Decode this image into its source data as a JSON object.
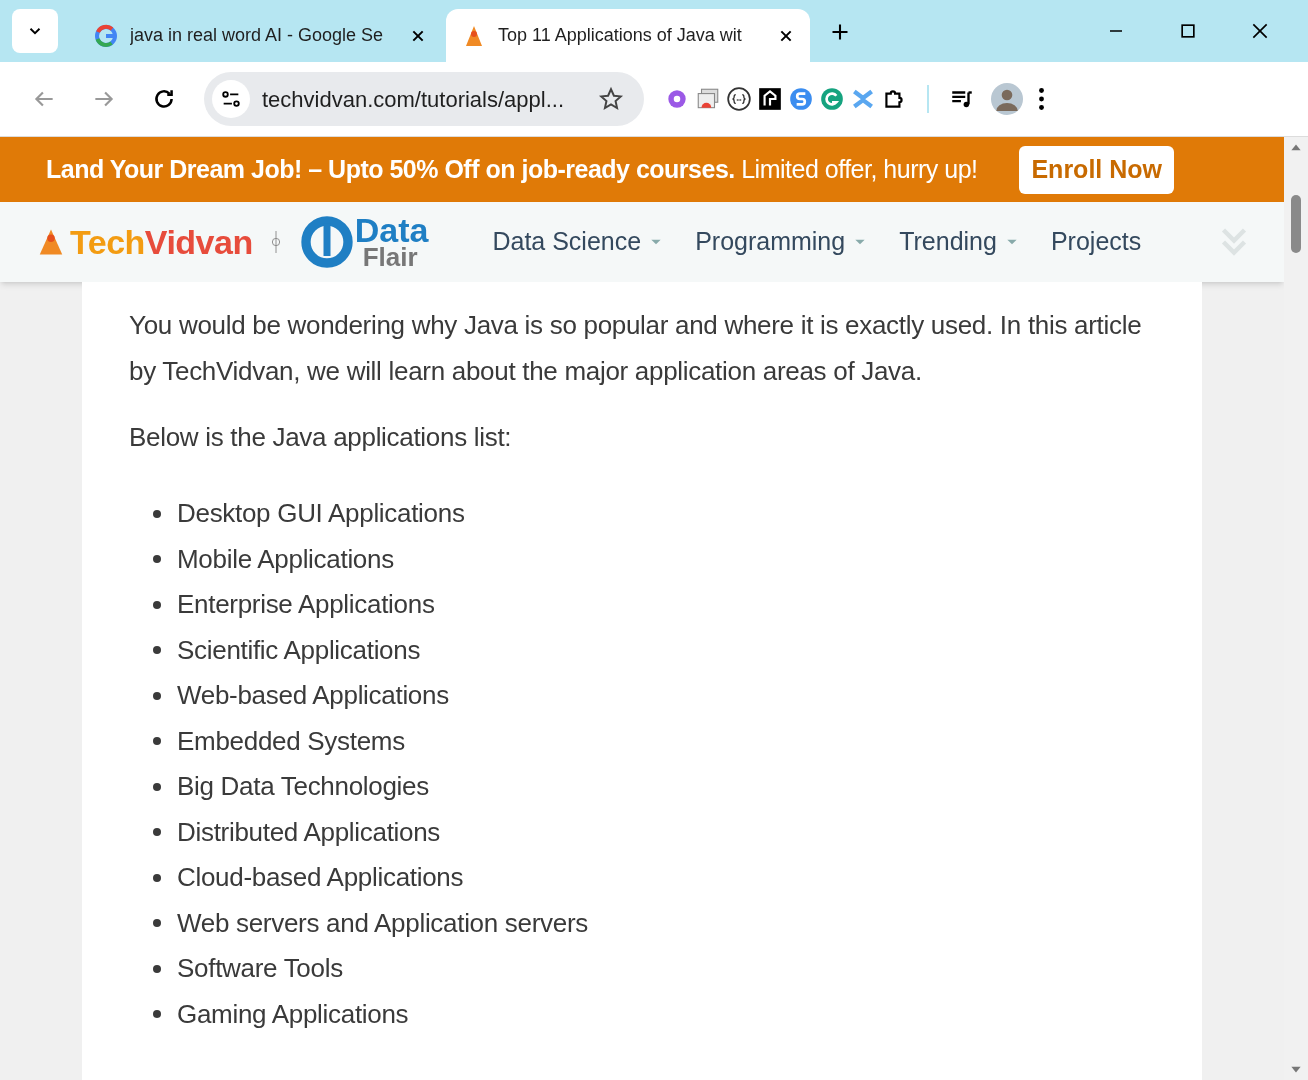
{
  "tabs": [
    {
      "title": "java in real word AI - Google Se",
      "selected": false
    },
    {
      "title": "Top 11 Applications of Java wit",
      "selected": true
    }
  ],
  "address_bar": {
    "url": "techvidvan.com/tutorials/appl..."
  },
  "banner": {
    "text": "**Land Your Dream Job! – Upto 50% Off on job-ready courses.** Limited offer, hurry up!",
    "button": "Enroll Now"
  },
  "logo": {
    "part_1": "Tech",
    "part_2": "Vidvan",
    "partner_1": "Data",
    "partner_2": "Flair"
  },
  "nav": [
    {
      "label": "Data Science",
      "dropdown": true
    },
    {
      "label": "Programming",
      "dropdown": true
    },
    {
      "label": "Trending",
      "dropdown": true
    },
    {
      "label": "Projects",
      "dropdown": false
    }
  ],
  "article": {
    "intro": "You would be wondering why Java is so popular and where it is exactly used. In this article by TechVidvan, we will learn about the major application areas of Java.",
    "list_heading": "Below is the Java applications list:",
    "items": [
      "Desktop GUI Applications",
      "Mobile Applications",
      "Enterprise Applications",
      "Scientific Applications",
      "Web-based Applications",
      "Embedded Systems",
      "Big Data Technologies",
      "Distributed Applications",
      "Cloud-based Applications",
      "Web servers and Application servers",
      "Software Tools",
      "Gaming Applications"
    ]
  }
}
